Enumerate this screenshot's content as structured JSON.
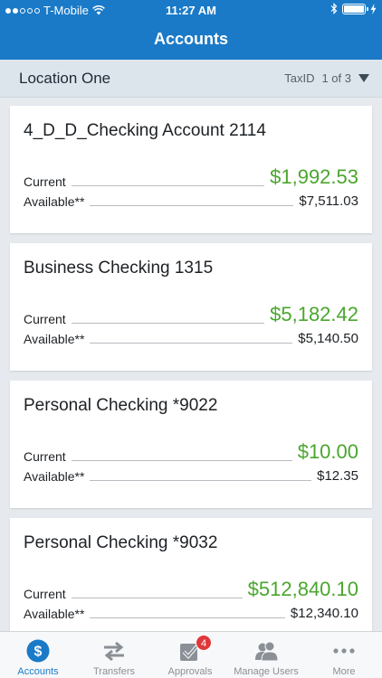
{
  "status": {
    "carrier": "T-Mobile",
    "time": "11:27 AM"
  },
  "nav": {
    "title": "Accounts"
  },
  "location": {
    "name": "Location One",
    "taxid_label": "TaxID",
    "page": "1 of  3"
  },
  "accounts": [
    {
      "name": "4_D_D_Checking Account 2114",
      "current_label": "Current",
      "current": "$1,992.53",
      "available_label": "Available**",
      "available": "$7,511.03"
    },
    {
      "name": "Business Checking 1315",
      "current_label": "Current",
      "current": "$5,182.42",
      "available_label": "Available**",
      "available": "$5,140.50"
    },
    {
      "name": "Personal Checking *9022",
      "current_label": "Current",
      "current": "$10.00",
      "available_label": "Available**",
      "available": "$12.35"
    },
    {
      "name": "Personal Checking *9032",
      "current_label": "Current",
      "current": "$512,840.10",
      "available_label": "Available**",
      "available": "$12,340.10"
    }
  ],
  "tabs": [
    {
      "label": "Accounts",
      "icon": "dollar-icon"
    },
    {
      "label": "Transfers",
      "icon": "transfer-arrows-icon"
    },
    {
      "label": "Approvals",
      "icon": "approvals-check-icon",
      "badge": "4"
    },
    {
      "label": "Manage Users",
      "icon": "users-icon"
    },
    {
      "label": "More",
      "icon": "more-dots-icon"
    }
  ],
  "colors": {
    "brand": "#1a7ac7",
    "positive": "#4aa62e",
    "badge": "#e0383a"
  }
}
